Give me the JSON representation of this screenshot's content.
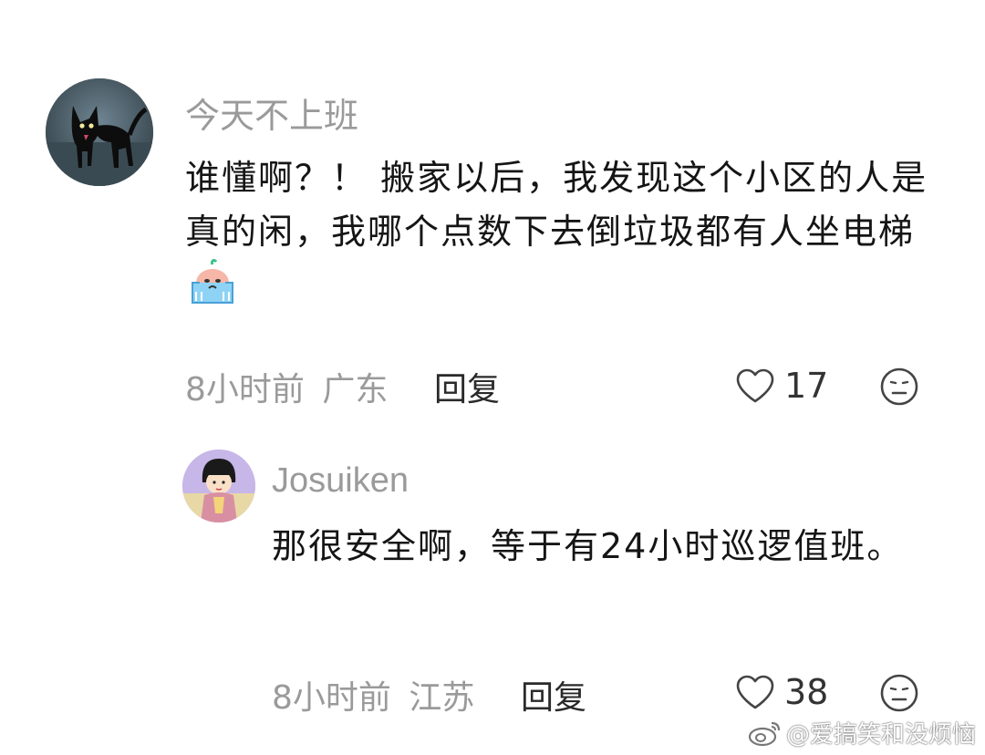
{
  "comments": [
    {
      "username": "今天不上班",
      "text_before_emoji": "谁懂啊？！ 搬家以后，我发现这个小区的人是真的闲，我哪个点数下去倒垃圾都有人坐电梯",
      "emoji_icon": "crying-sticker-icon",
      "time": "8小时前",
      "location": "广东",
      "reply_label": "回复",
      "like_count": "17"
    },
    {
      "username": "Josuiken",
      "text": "那很安全啊，等于有24小时巡逻值班。",
      "time": "8小时前",
      "location": "江苏",
      "reply_label": "回复",
      "like_count": "38"
    }
  ],
  "watermark": {
    "icon": "weibo-logo-icon",
    "text": "@爱搞笑和没烦恼"
  },
  "colors": {
    "meta_gray": "#9a9a9a",
    "text_dark": "#151515"
  }
}
